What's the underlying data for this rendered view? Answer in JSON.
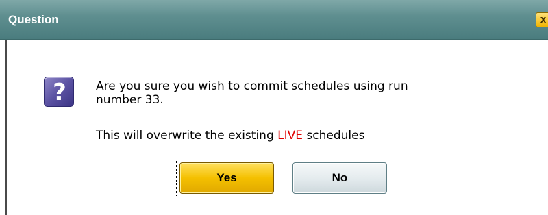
{
  "dialog": {
    "title": "Question",
    "close_label": "x",
    "icon": "question-icon",
    "icon_glyph": "?",
    "message_line1": "Are you sure you wish to commit schedules using run",
    "message_line2": "number 33.",
    "warning_prefix": "This will overwrite the existing ",
    "warning_highlight": "LIVE",
    "warning_suffix": " schedules",
    "yes_label": "Yes",
    "no_label": "No"
  },
  "colors": {
    "titlebar": "#5f8f90",
    "highlight": "#e00000",
    "yes_button": "#f4c000",
    "close_button": "#f0b400"
  }
}
